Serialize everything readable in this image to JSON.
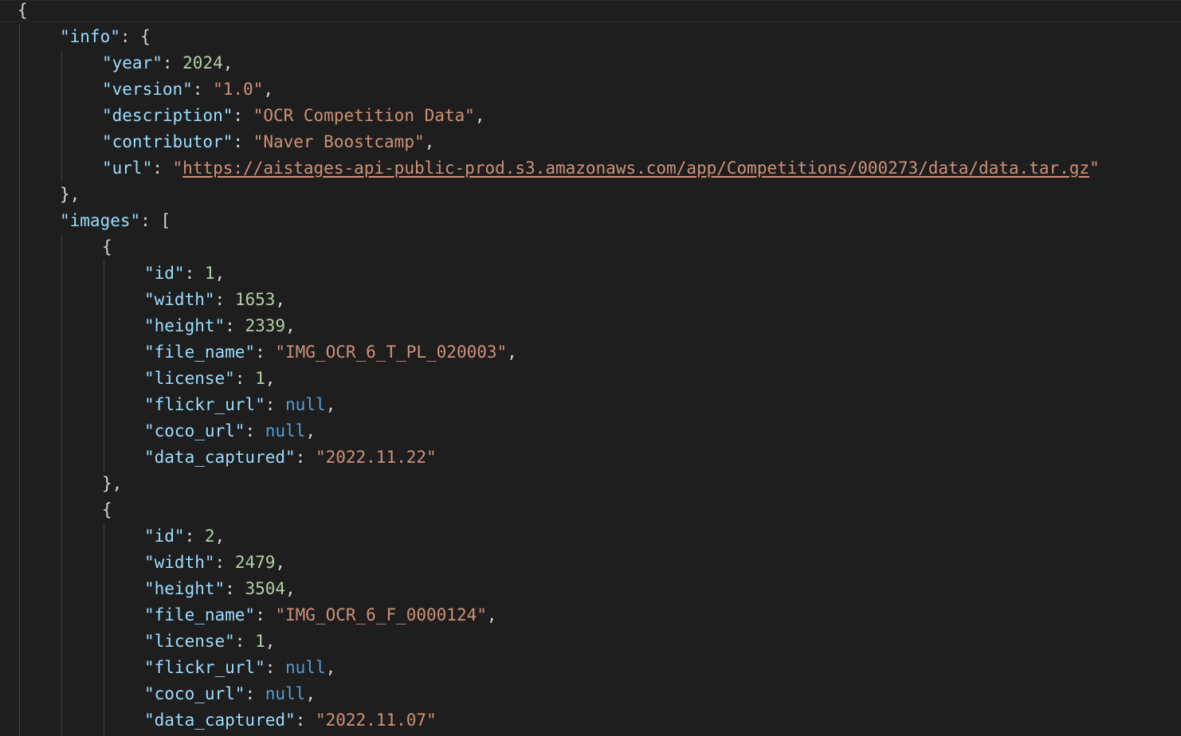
{
  "editor": {
    "theme": {
      "background": "#1e1e1e",
      "key_color": "#9cdcfe",
      "string_color": "#ce9178",
      "number_color": "#b5cea8",
      "null_color": "#569cd6",
      "punctuation_color": "#d4d4d4"
    },
    "lines": [
      {
        "indent": 0,
        "tokens": [
          {
            "t": "punc",
            "v": "{"
          }
        ]
      },
      {
        "indent": 1,
        "tokens": [
          {
            "t": "key",
            "v": "\"info\""
          },
          {
            "t": "punc",
            "v": ": {"
          }
        ]
      },
      {
        "indent": 2,
        "tokens": [
          {
            "t": "key",
            "v": "\"year\""
          },
          {
            "t": "punc",
            "v": ": "
          },
          {
            "t": "num",
            "v": "2024"
          },
          {
            "t": "punc",
            "v": ","
          }
        ]
      },
      {
        "indent": 2,
        "tokens": [
          {
            "t": "key",
            "v": "\"version\""
          },
          {
            "t": "punc",
            "v": ": "
          },
          {
            "t": "str",
            "v": "\"1.0\""
          },
          {
            "t": "punc",
            "v": ","
          }
        ]
      },
      {
        "indent": 2,
        "tokens": [
          {
            "t": "key",
            "v": "\"description\""
          },
          {
            "t": "punc",
            "v": ": "
          },
          {
            "t": "str",
            "v": "\"OCR Competition Data\""
          },
          {
            "t": "punc",
            "v": ","
          }
        ]
      },
      {
        "indent": 2,
        "tokens": [
          {
            "t": "key",
            "v": "\"contributor\""
          },
          {
            "t": "punc",
            "v": ": "
          },
          {
            "t": "str",
            "v": "\"Naver Boostcamp\""
          },
          {
            "t": "punc",
            "v": ","
          }
        ]
      },
      {
        "indent": 2,
        "tokens": [
          {
            "t": "key",
            "v": "\"url\""
          },
          {
            "t": "punc",
            "v": ": "
          },
          {
            "t": "str",
            "v": "\""
          },
          {
            "t": "link",
            "v": "https://aistages-api-public-prod.s3.amazonaws.com/app/Competitions/000273/data/data.tar.gz"
          },
          {
            "t": "str",
            "v": "\""
          }
        ]
      },
      {
        "indent": 1,
        "tokens": [
          {
            "t": "punc",
            "v": "},"
          }
        ]
      },
      {
        "indent": 1,
        "tokens": [
          {
            "t": "key",
            "v": "\"images\""
          },
          {
            "t": "punc",
            "v": ": ["
          }
        ]
      },
      {
        "indent": 2,
        "tokens": [
          {
            "t": "punc",
            "v": "{"
          }
        ]
      },
      {
        "indent": 3,
        "tokens": [
          {
            "t": "key",
            "v": "\"id\""
          },
          {
            "t": "punc",
            "v": ": "
          },
          {
            "t": "num",
            "v": "1"
          },
          {
            "t": "punc",
            "v": ","
          }
        ]
      },
      {
        "indent": 3,
        "tokens": [
          {
            "t": "key",
            "v": "\"width\""
          },
          {
            "t": "punc",
            "v": ": "
          },
          {
            "t": "num",
            "v": "1653"
          },
          {
            "t": "punc",
            "v": ","
          }
        ]
      },
      {
        "indent": 3,
        "tokens": [
          {
            "t": "key",
            "v": "\"height\""
          },
          {
            "t": "punc",
            "v": ": "
          },
          {
            "t": "num",
            "v": "2339"
          },
          {
            "t": "punc",
            "v": ","
          }
        ]
      },
      {
        "indent": 3,
        "tokens": [
          {
            "t": "key",
            "v": "\"file_name\""
          },
          {
            "t": "punc",
            "v": ": "
          },
          {
            "t": "str",
            "v": "\"IMG_OCR_6_T_PL_020003\""
          },
          {
            "t": "punc",
            "v": ","
          }
        ]
      },
      {
        "indent": 3,
        "tokens": [
          {
            "t": "key",
            "v": "\"license\""
          },
          {
            "t": "punc",
            "v": ": "
          },
          {
            "t": "num",
            "v": "1"
          },
          {
            "t": "punc",
            "v": ","
          }
        ]
      },
      {
        "indent": 3,
        "tokens": [
          {
            "t": "key",
            "v": "\"flickr_url\""
          },
          {
            "t": "punc",
            "v": ": "
          },
          {
            "t": "nul",
            "v": "null"
          },
          {
            "t": "punc",
            "v": ","
          }
        ]
      },
      {
        "indent": 3,
        "tokens": [
          {
            "t": "key",
            "v": "\"coco_url\""
          },
          {
            "t": "punc",
            "v": ": "
          },
          {
            "t": "nul",
            "v": "null"
          },
          {
            "t": "punc",
            "v": ","
          }
        ]
      },
      {
        "indent": 3,
        "tokens": [
          {
            "t": "key",
            "v": "\"data_captured\""
          },
          {
            "t": "punc",
            "v": ": "
          },
          {
            "t": "str",
            "v": "\"2022.11.22\""
          }
        ]
      },
      {
        "indent": 2,
        "tokens": [
          {
            "t": "punc",
            "v": "},"
          }
        ]
      },
      {
        "indent": 2,
        "tokens": [
          {
            "t": "punc",
            "v": "{"
          }
        ]
      },
      {
        "indent": 3,
        "tokens": [
          {
            "t": "key",
            "v": "\"id\""
          },
          {
            "t": "punc",
            "v": ": "
          },
          {
            "t": "num",
            "v": "2"
          },
          {
            "t": "punc",
            "v": ","
          }
        ]
      },
      {
        "indent": 3,
        "tokens": [
          {
            "t": "key",
            "v": "\"width\""
          },
          {
            "t": "punc",
            "v": ": "
          },
          {
            "t": "num",
            "v": "2479"
          },
          {
            "t": "punc",
            "v": ","
          }
        ]
      },
      {
        "indent": 3,
        "tokens": [
          {
            "t": "key",
            "v": "\"height\""
          },
          {
            "t": "punc",
            "v": ": "
          },
          {
            "t": "num",
            "v": "3504"
          },
          {
            "t": "punc",
            "v": ","
          }
        ]
      },
      {
        "indent": 3,
        "tokens": [
          {
            "t": "key",
            "v": "\"file_name\""
          },
          {
            "t": "punc",
            "v": ": "
          },
          {
            "t": "str",
            "v": "\"IMG_OCR_6_F_0000124\""
          },
          {
            "t": "punc",
            "v": ","
          }
        ]
      },
      {
        "indent": 3,
        "tokens": [
          {
            "t": "key",
            "v": "\"license\""
          },
          {
            "t": "punc",
            "v": ": "
          },
          {
            "t": "num",
            "v": "1"
          },
          {
            "t": "punc",
            "v": ","
          }
        ]
      },
      {
        "indent": 3,
        "tokens": [
          {
            "t": "key",
            "v": "\"flickr_url\""
          },
          {
            "t": "punc",
            "v": ": "
          },
          {
            "t": "nul",
            "v": "null"
          },
          {
            "t": "punc",
            "v": ","
          }
        ]
      },
      {
        "indent": 3,
        "tokens": [
          {
            "t": "key",
            "v": "\"coco_url\""
          },
          {
            "t": "punc",
            "v": ": "
          },
          {
            "t": "nul",
            "v": "null"
          },
          {
            "t": "punc",
            "v": ","
          }
        ]
      },
      {
        "indent": 3,
        "tokens": [
          {
            "t": "key",
            "v": "\"data_captured\""
          },
          {
            "t": "punc",
            "v": ": "
          },
          {
            "t": "str",
            "v": "\"2022.11.07\""
          }
        ]
      }
    ]
  }
}
